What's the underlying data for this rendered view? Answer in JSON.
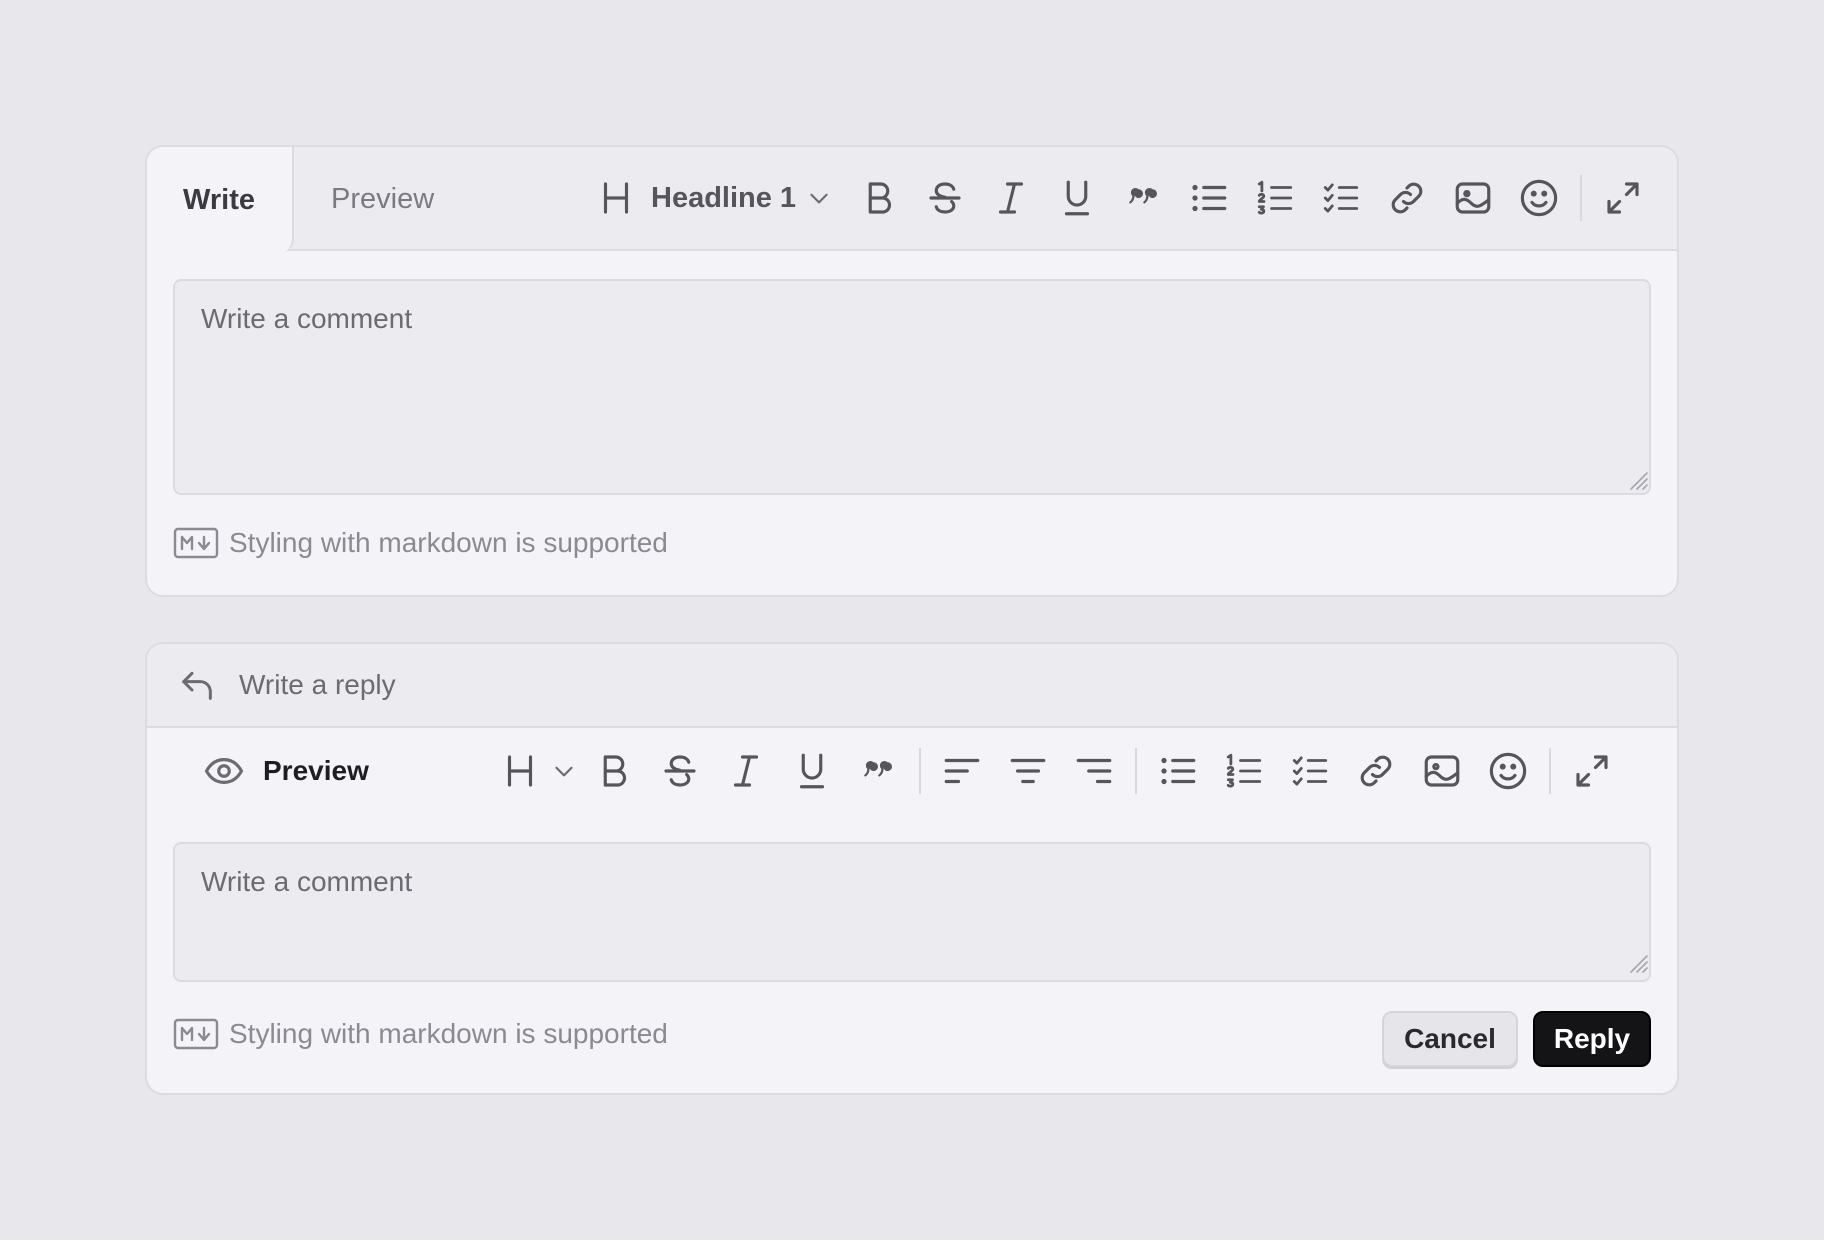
{
  "editor": {
    "tabs": {
      "write": "Write",
      "preview": "Preview"
    },
    "heading_select": "Headline 1",
    "placeholder": "Write a comment",
    "markdown_note": "Styling with markdown is supported"
  },
  "reply_editor": {
    "header": "Write a reply",
    "preview_label": "Preview",
    "placeholder": "Write a comment",
    "markdown_note": "Styling with markdown is supported",
    "cancel_label": "Cancel",
    "reply_label": "Reply"
  },
  "icons": {
    "editor_toolbar": [
      "heading-icon",
      "chevron-down-icon",
      "bold-icon",
      "strikethrough-icon",
      "italic-icon",
      "underline-icon",
      "quote-icon",
      "bullet-list-icon",
      "numbered-list-icon",
      "checklist-icon",
      "link-icon",
      "image-icon",
      "emoji-icon",
      "expand-icon"
    ],
    "reply_toolbar": [
      "heading-icon",
      "chevron-down-icon",
      "bold-icon",
      "strikethrough-icon",
      "italic-icon",
      "underline-icon",
      "quote-icon",
      "align-left-icon",
      "align-center-icon",
      "align-right-icon",
      "bullet-list-icon",
      "numbered-list-icon",
      "checklist-icon",
      "link-icon",
      "image-icon",
      "emoji-icon",
      "expand-icon"
    ],
    "other": [
      "reply-arrow-icon",
      "eye-icon",
      "markdown-icon",
      "resize-handle-icon"
    ]
  },
  "colors": {
    "background": "#e8e7ec",
    "card": "#f4f3f8",
    "primary_button": "#141416",
    "icon": "#55555b"
  }
}
